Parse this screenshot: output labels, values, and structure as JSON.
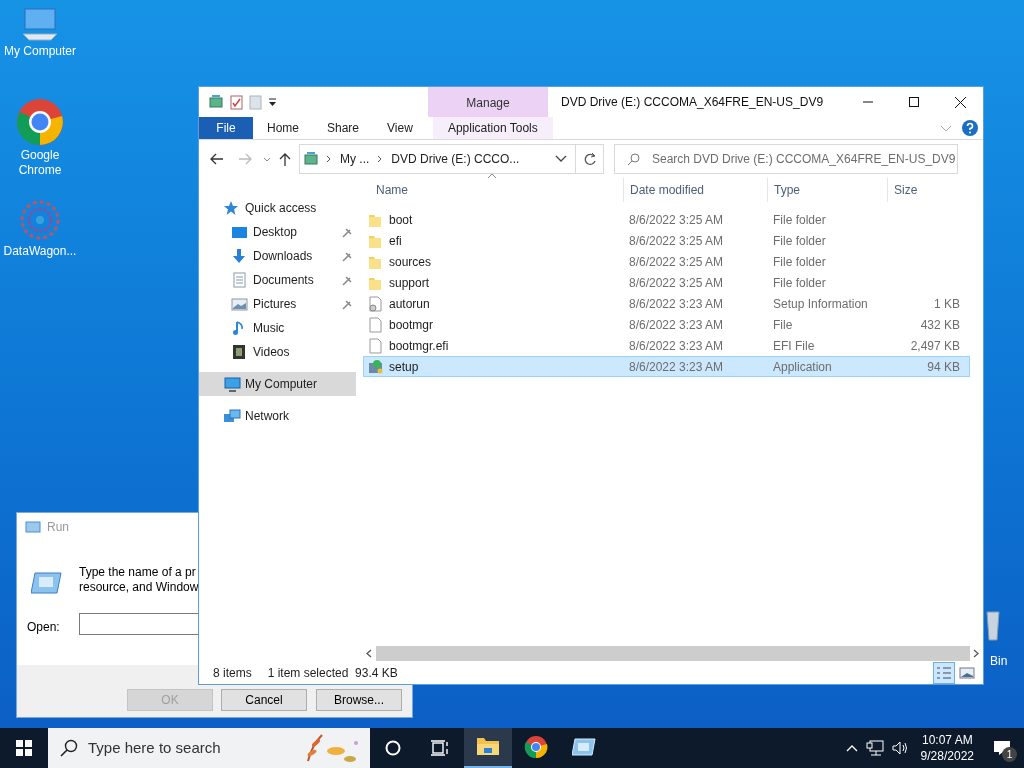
{
  "desktop": {
    "icons": [
      {
        "kind": "computer",
        "label": "My Computer"
      },
      {
        "kind": "chrome",
        "label": "Google Chrome"
      },
      {
        "kind": "flower",
        "label": "DataWagon..."
      }
    ],
    "recycle_bin": {
      "label": "Bin"
    }
  },
  "run_dialog": {
    "title": "Run",
    "description": [
      "Type the name of a pr",
      "resource, and Window"
    ],
    "open_label": "Open:",
    "buttons": [
      {
        "label": "OK",
        "disabled": true
      },
      {
        "label": "Cancel",
        "disabled": false
      },
      {
        "label": "Browse...",
        "disabled": false
      }
    ]
  },
  "explorer": {
    "title": "DVD Drive (E:) CCCOMA_X64FRE_EN-US_DV9",
    "contextual_group": "Manage",
    "ribbon_tabs": [
      {
        "label": "File",
        "kind": "file"
      },
      {
        "label": "Home",
        "kind": "tab"
      },
      {
        "label": "Share",
        "kind": "tab"
      },
      {
        "label": "View",
        "kind": "tab"
      },
      {
        "label": "Application Tools",
        "kind": "contextual"
      }
    ],
    "breadcrumbs": [
      "My ...",
      "DVD Drive (E:) CCCO..."
    ],
    "search": {
      "placeholder": "Search DVD Drive (E:) CCCOMA_X64FRE_EN-US_DV9"
    },
    "nav": [
      {
        "kind": "star",
        "label": "Quick access",
        "pinned": false,
        "selected": false,
        "children": [
          {
            "kind": "desktop",
            "label": "Desktop",
            "pinned": true,
            "selected": false
          },
          {
            "kind": "download",
            "label": "Downloads",
            "pinned": true,
            "selected": false
          },
          {
            "kind": "document",
            "label": "Documents",
            "pinned": true,
            "selected": false
          },
          {
            "kind": "pictures",
            "label": "Pictures",
            "pinned": true,
            "selected": false
          },
          {
            "kind": "music",
            "label": "Music",
            "pinned": false,
            "selected": false
          },
          {
            "kind": "video",
            "label": "Videos",
            "pinned": false,
            "selected": false
          }
        ]
      },
      {
        "kind": "computer",
        "label": "My Computer",
        "pinned": false,
        "selected": true
      },
      {
        "kind": "network",
        "label": "Network",
        "pinned": false,
        "selected": false
      }
    ],
    "columns": [
      "Name",
      "Date modified",
      "Type",
      "Size"
    ],
    "files": [
      {
        "kind": "folder",
        "name": "boot",
        "date": "8/6/2022 3:25 AM",
        "type": "File folder",
        "selected": false
      },
      {
        "kind": "folder",
        "name": "efi",
        "date": "8/6/2022 3:25 AM",
        "type": "File folder",
        "selected": false
      },
      {
        "kind": "folder",
        "name": "sources",
        "date": "8/6/2022 3:25 AM",
        "type": "File folder",
        "selected": false
      },
      {
        "kind": "folder",
        "name": "support",
        "date": "8/6/2022 3:25 AM",
        "type": "File folder",
        "selected": false
      },
      {
        "kind": "settings",
        "name": "autorun",
        "date": "8/6/2022 3:23 AM",
        "type": "Setup Information",
        "size": "1 KB",
        "selected": false
      },
      {
        "kind": "file",
        "name": "bootmgr",
        "date": "8/6/2022 3:23 AM",
        "type": "File",
        "size": "432 KB",
        "selected": false
      },
      {
        "kind": "file",
        "name": "bootmgr.efi",
        "date": "8/6/2022 3:23 AM",
        "type": "EFI File",
        "size": "2,497 KB",
        "selected": false
      },
      {
        "kind": "app",
        "name": "setup",
        "date": "8/6/2022 3:23 AM",
        "type": "Application",
        "size": "94 KB",
        "selected": true
      }
    ],
    "status": {
      "count": "8 items",
      "selection": "1 item selected  93.4 KB"
    }
  },
  "taskbar": {
    "search": {
      "placeholder": "Type here to search"
    },
    "apps": [
      {
        "kind": "explorer",
        "active": true
      },
      {
        "kind": "chrome",
        "active": false
      },
      {
        "kind": "run",
        "active": false
      }
    ],
    "time": "10:07 AM",
    "date": "9/28/2022",
    "notifications": "1"
  }
}
